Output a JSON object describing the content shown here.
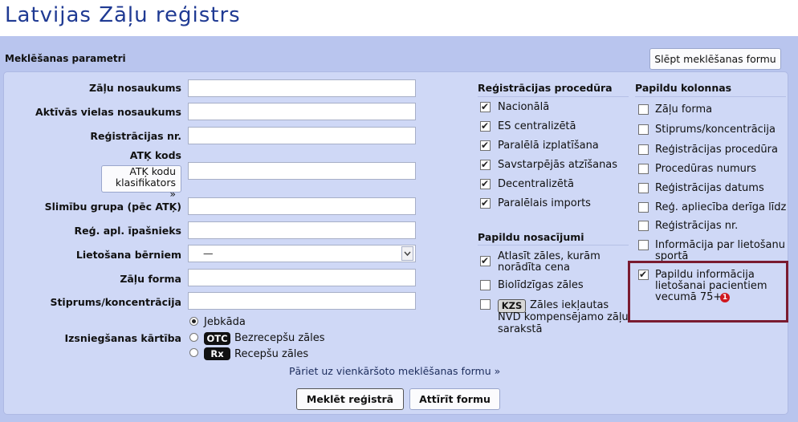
{
  "header": {
    "title": "Latvijas Zāļu reģistrs"
  },
  "search_panel": {
    "heading": "Meklēšanas parametri",
    "hide_button": "Slēpt meklēšanas formu"
  },
  "fields": {
    "name": {
      "label": "Zāļu nosaukums",
      "value": ""
    },
    "active_substance": {
      "label": "Aktīvās vielas nosaukums",
      "value": ""
    },
    "reg_number": {
      "label": "Reģistrācijas nr.",
      "value": ""
    },
    "atk": {
      "label": "ATĶ kods",
      "value": "",
      "button": "ATĶ kodu klasifikators »"
    },
    "disease_group": {
      "label": "Slimību grupa (pēc ATĶ)",
      "value": ""
    },
    "holder": {
      "label": "Reģ. apl. īpašnieks",
      "value": ""
    },
    "children": {
      "label": "Lietošana bērniem",
      "selected": "—"
    },
    "form": {
      "label": "Zāļu forma",
      "value": ""
    },
    "strength": {
      "label": "Stiprums/koncentrācija",
      "value": ""
    }
  },
  "dispensing": {
    "label": "Izsniegšanas kārtība",
    "options": [
      {
        "label": "Jebkāda",
        "badge": "",
        "selected": true
      },
      {
        "label": "Bezrecepšu zāles",
        "badge": "OTC",
        "selected": false
      },
      {
        "label": "Recepšu zāles",
        "badge": "Rx",
        "selected": false
      }
    ]
  },
  "registration_procedure": {
    "heading": "Reģistrācijas procedūra",
    "items": [
      {
        "label": "Nacionālā",
        "checked": true
      },
      {
        "label": "ES centralizētā",
        "checked": true
      },
      {
        "label": "Paralēlā izplatīšana",
        "checked": true
      },
      {
        "label": "Savstarpējās atzīšanas",
        "checked": true
      },
      {
        "label": "Decentralizētā",
        "checked": true
      },
      {
        "label": "Paralēlais imports",
        "checked": true
      }
    ]
  },
  "extra_conditions": {
    "heading": "Papildu nosacījumi",
    "items": [
      {
        "label_line1": "Atlasīt zāles, kurām",
        "label_line2": "norādīta cena",
        "checked": true
      },
      {
        "label": "Biolīdzīgas zāles",
        "checked": false
      },
      {
        "badge": "KZS",
        "label_line1": "Zāles iekļautas",
        "label_line2": "NVD kompensējamo zāļu",
        "label_line3": "sarakstā",
        "checked": false
      }
    ]
  },
  "extra_columns": {
    "heading": "Papildu kolonnas",
    "items": [
      {
        "label": "Zāļu forma",
        "checked": false
      },
      {
        "label": "Stiprums/koncentrācija",
        "checked": false
      },
      {
        "label": "Reģistrācijas procedūra",
        "checked": false
      },
      {
        "label": "Procedūras numurs",
        "checked": false
      },
      {
        "label": "Reģistrācijas datums",
        "checked": false
      },
      {
        "label": "Reģ. apliecība derīga līdz",
        "checked": false
      },
      {
        "label": "Reģistrācijas nr.",
        "checked": false
      },
      {
        "label_line1": "Informācija par lietošanu",
        "label_line2": "sportā",
        "checked": false
      },
      {
        "label_line1": "Papildu informācija",
        "label_line2": "lietošanai pacientiem",
        "label_line3": "vecumā 75+",
        "new_badge": "1",
        "checked": true
      }
    ]
  },
  "actions": {
    "simple_search_link": "Pāriet uz vienkāršoto meklēšanas formu »",
    "submit": "Meklēt reģistrā",
    "reset": "Attīrīt formu"
  },
  "colors": {
    "title": "#1f3a93",
    "panel": "#b9c5ee",
    "form_bg": "#cfd8f6",
    "highlight_border": "#7a1b30",
    "new_badge": "#d0181f"
  }
}
